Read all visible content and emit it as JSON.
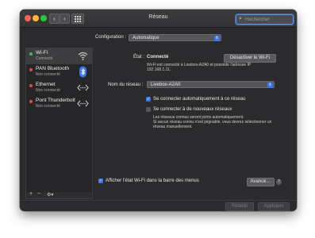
{
  "window": {
    "title": "Réseau"
  },
  "search": {
    "placeholder": "Rechercher"
  },
  "config": {
    "label": "Configuration :",
    "value": "Automatique"
  },
  "sidebar": {
    "items": [
      {
        "name": "Wi-Fi",
        "status": "Connecté",
        "dot_color": "#3ac25a",
        "icon": "wifi-icon"
      },
      {
        "name": "PAN Bluetooth",
        "status": "Non connecté",
        "dot_color": "#e34848",
        "icon": "bluetooth-icon"
      },
      {
        "name": "Ethernet",
        "status": "Non connecté",
        "dot_color": "#e34848",
        "icon": "ethernet-icon"
      },
      {
        "name": "Pont Thunderbolt",
        "status": "Non connecté",
        "dot_color": "#e34848",
        "icon": "thunderbolt-bridge-icon"
      }
    ],
    "add": "+",
    "remove": "−",
    "actions": "⚙▾"
  },
  "detail": {
    "status_label": "État :",
    "status_value": "Connecté",
    "disable_button": "Désactiver le Wi-Fi",
    "status_desc_1": "Wi-Fi est connecté à Livebox-A2A0 et possède l'adresse IP",
    "status_desc_2": "192.168.1.11.",
    "network_label": "Nom du réseau :",
    "network_value": "Livebox-A2A0",
    "auto_join": "Se connecter automatiquement à ce réseau",
    "ask_new": "Se connecter à de nouveaux réseaux",
    "known_note_1": "Les réseaux connus seront joints automatiquement.",
    "known_note_2": "Si aucun réseau connu n'est joignable, vous devrez sélectionner un",
    "known_note_3": "réseau manuellement.",
    "show_menubar": "Afficher l'état Wi-Fi dans la barre des menus",
    "advanced": "Avancé…",
    "help": "?"
  },
  "footer": {
    "revert": "Rétablir",
    "apply": "Appliquer"
  },
  "colors": {
    "accent": "#3a78f2",
    "connected": "#3ac25a",
    "disconnected": "#e34848"
  }
}
